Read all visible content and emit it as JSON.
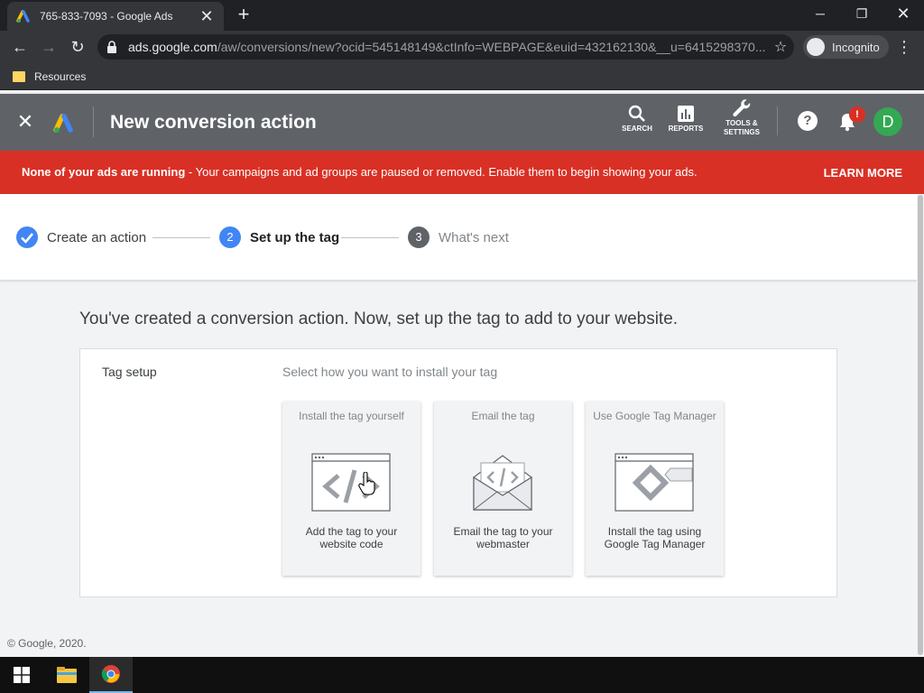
{
  "browser": {
    "tab_title": "765-833-7093 - Google Ads",
    "url_host": "ads.google.com",
    "url_path": "/aw/conversions/new?ocid=545148149&ctInfo=WEBPAGE&euid=432162130&__u=6415298370...",
    "profile_label": "Incognito",
    "bookmark": "Resources"
  },
  "header": {
    "title": "New conversion action",
    "search_label": "SEARCH",
    "reports_label": "REPORTS",
    "tools_label_1": "TOOLS &",
    "tools_label_2": "SETTINGS",
    "help_glyph": "?",
    "notif_badge": "!",
    "avatar_initial": "D"
  },
  "banner": {
    "bold": "None of your ads are running",
    "text": " - Your campaigns and ad groups are paused or removed. Enable them to begin showing your ads.",
    "action": "LEARN MORE"
  },
  "stepper": {
    "steps": [
      {
        "num": "✓",
        "label": "Create an action"
      },
      {
        "num": "2",
        "label": "Set up the tag"
      },
      {
        "num": "3",
        "label": "What's next"
      }
    ]
  },
  "main": {
    "headline": "You've created a conversion action. Now, set up the tag to add to your website.",
    "section_title": "Tag setup",
    "prompt": "Select how you want to install your tag",
    "options": [
      {
        "title": "Install the tag yourself",
        "desc": "Add the tag to your website code"
      },
      {
        "title": "Email the tag",
        "desc": "Email the tag to your webmaster"
      },
      {
        "title": "Use Google Tag Manager",
        "desc": "Install the tag using Google Tag Manager"
      }
    ]
  },
  "footer": "© Google, 2020.",
  "colors": {
    "banner": "#d93025",
    "header": "#5f6368",
    "step_active": "#4285f4",
    "step_done": "#4285f4",
    "step_pending": "#5f6368",
    "avatar": "#34a853"
  }
}
